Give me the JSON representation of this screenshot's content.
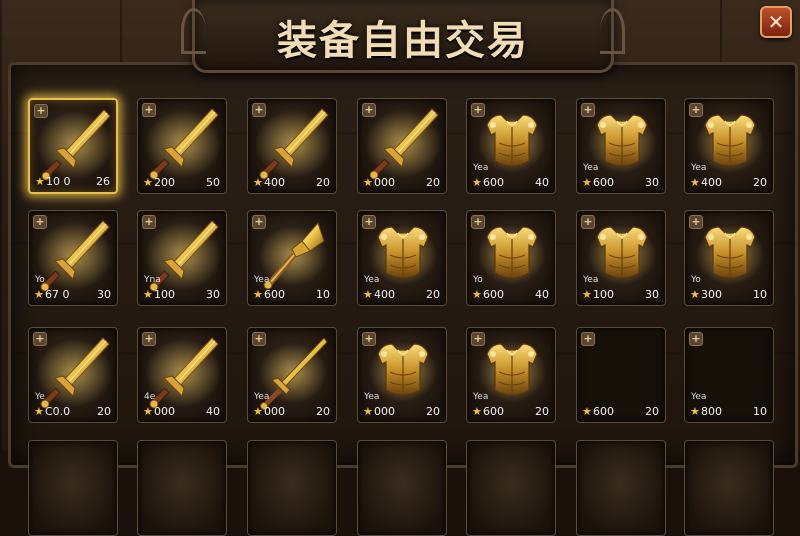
{
  "title": "装备自由交易",
  "close_label": "✕",
  "plus_label": "+",
  "star_glyph": "★",
  "colors": {
    "gold": "#e8c04a",
    "wood": "#2b2016",
    "close": "#c0502a"
  },
  "slots": [
    {
      "item": "sword",
      "tag": "",
      "price": "10 0",
      "count": "26",
      "selected": true
    },
    {
      "item": "sword",
      "tag": "",
      "price": "200",
      "count": "50",
      "selected": false
    },
    {
      "item": "sword",
      "tag": "",
      "price": "400",
      "count": "20",
      "selected": false
    },
    {
      "item": "sword",
      "tag": "",
      "price": "000",
      "count": "20",
      "selected": false
    },
    {
      "item": "armor",
      "tag": "Yea",
      "price": "600",
      "count": "40",
      "selected": false
    },
    {
      "item": "armor",
      "tag": "Yea",
      "price": "600",
      "count": "30",
      "selected": false
    },
    {
      "item": "armor",
      "tag": "Yea",
      "price": "400",
      "count": "20",
      "selected": false
    },
    {
      "item": "sword",
      "tag": "Yo",
      "price": "67 0",
      "count": "30",
      "selected": false
    },
    {
      "item": "sword",
      "tag": "Yna",
      "price": "100",
      "count": "30",
      "selected": false
    },
    {
      "item": "mace",
      "tag": "Yea",
      "price": "600",
      "count": "10",
      "selected": false
    },
    {
      "item": "armor",
      "tag": "Yea",
      "price": "400",
      "count": "20",
      "selected": false
    },
    {
      "item": "armor",
      "tag": "Yo",
      "price": "600",
      "count": "40",
      "selected": false
    },
    {
      "item": "armor",
      "tag": "Yea",
      "price": "100",
      "count": "30",
      "selected": false
    },
    {
      "item": "armor",
      "tag": "Yo",
      "price": "300",
      "count": "10",
      "selected": false
    },
    {
      "item": "sword",
      "tag": "Ye",
      "price": "C0.0",
      "count": "20",
      "selected": false
    },
    {
      "item": "sword",
      "tag": "4e",
      "price": "000",
      "count": "40",
      "selected": false
    },
    {
      "item": "longsword",
      "tag": "Yea",
      "price": "000",
      "count": "20",
      "selected": false
    },
    {
      "item": "armor",
      "tag": "Yea",
      "price": "000",
      "count": "20",
      "selected": false
    },
    {
      "item": "armor",
      "tag": "Yea",
      "price": "600",
      "count": "20",
      "selected": false
    },
    {
      "item": "empty",
      "tag": "",
      "price": "600",
      "count": "20",
      "selected": false
    },
    {
      "item": "empty",
      "tag": "Yea",
      "price": "800",
      "count": "10",
      "selected": false
    }
  ]
}
